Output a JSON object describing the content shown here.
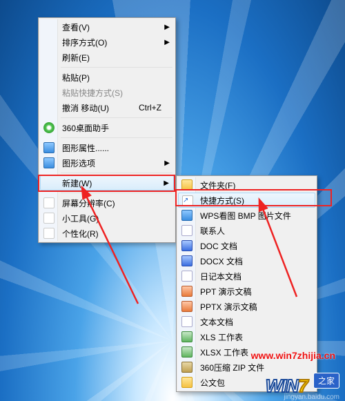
{
  "menu1": {
    "items": [
      {
        "label": "查看(V)",
        "type": "submenu"
      },
      {
        "label": "排序方式(O)",
        "type": "submenu"
      },
      {
        "label": "刷新(E)"
      },
      {
        "sep": true
      },
      {
        "label": "粘贴(P)"
      },
      {
        "label": "粘贴快捷方式(S)",
        "disabled": true
      },
      {
        "label": "撤消 移动(U)",
        "shortcut": "Ctrl+Z"
      },
      {
        "sep": true
      },
      {
        "label": "360桌面助手",
        "icon": "360"
      },
      {
        "sep": true
      },
      {
        "label": "图形属性......",
        "icon": "blue"
      },
      {
        "label": "图形选项",
        "icon": "blue",
        "type": "submenu"
      },
      {
        "sep": true
      },
      {
        "label": "新建(W)",
        "type": "submenu",
        "selected": true
      },
      {
        "sep": true
      },
      {
        "label": "屏幕分辨率(C)",
        "icon": "desk"
      },
      {
        "label": "小工具(G)",
        "icon": "desk"
      },
      {
        "label": "个性化(R)",
        "icon": "desk"
      }
    ]
  },
  "menu2": {
    "items": [
      {
        "label": "文件夹(F)",
        "icon": "folder"
      },
      {
        "label": "快捷方式(S)",
        "icon": "shortcut",
        "selected": true
      },
      {
        "label": "WPS看图 BMP 图片文件",
        "icon": "blue"
      },
      {
        "label": "联系人",
        "icon": "doc"
      },
      {
        "label": "DOC 文档",
        "icon": "w"
      },
      {
        "label": "DOCX 文档",
        "icon": "w"
      },
      {
        "label": "日记本文档",
        "icon": "doc"
      },
      {
        "label": "PPT 演示文稿",
        "icon": "p"
      },
      {
        "label": "PPTX 演示文稿",
        "icon": "p"
      },
      {
        "label": "文本文档",
        "icon": "doc"
      },
      {
        "label": "XLS 工作表",
        "icon": "x"
      },
      {
        "label": "XLSX 工作表",
        "icon": "x"
      },
      {
        "label": "360压缩 ZIP 文件",
        "icon": "zip"
      },
      {
        "label": "公文包",
        "icon": "folder"
      }
    ]
  },
  "watermark": "www.win7zhijia.cn",
  "logo_main": "WIN",
  "logo_seven": "7",
  "logo_sub": "之家",
  "credit": "jingyan.baidu.com"
}
